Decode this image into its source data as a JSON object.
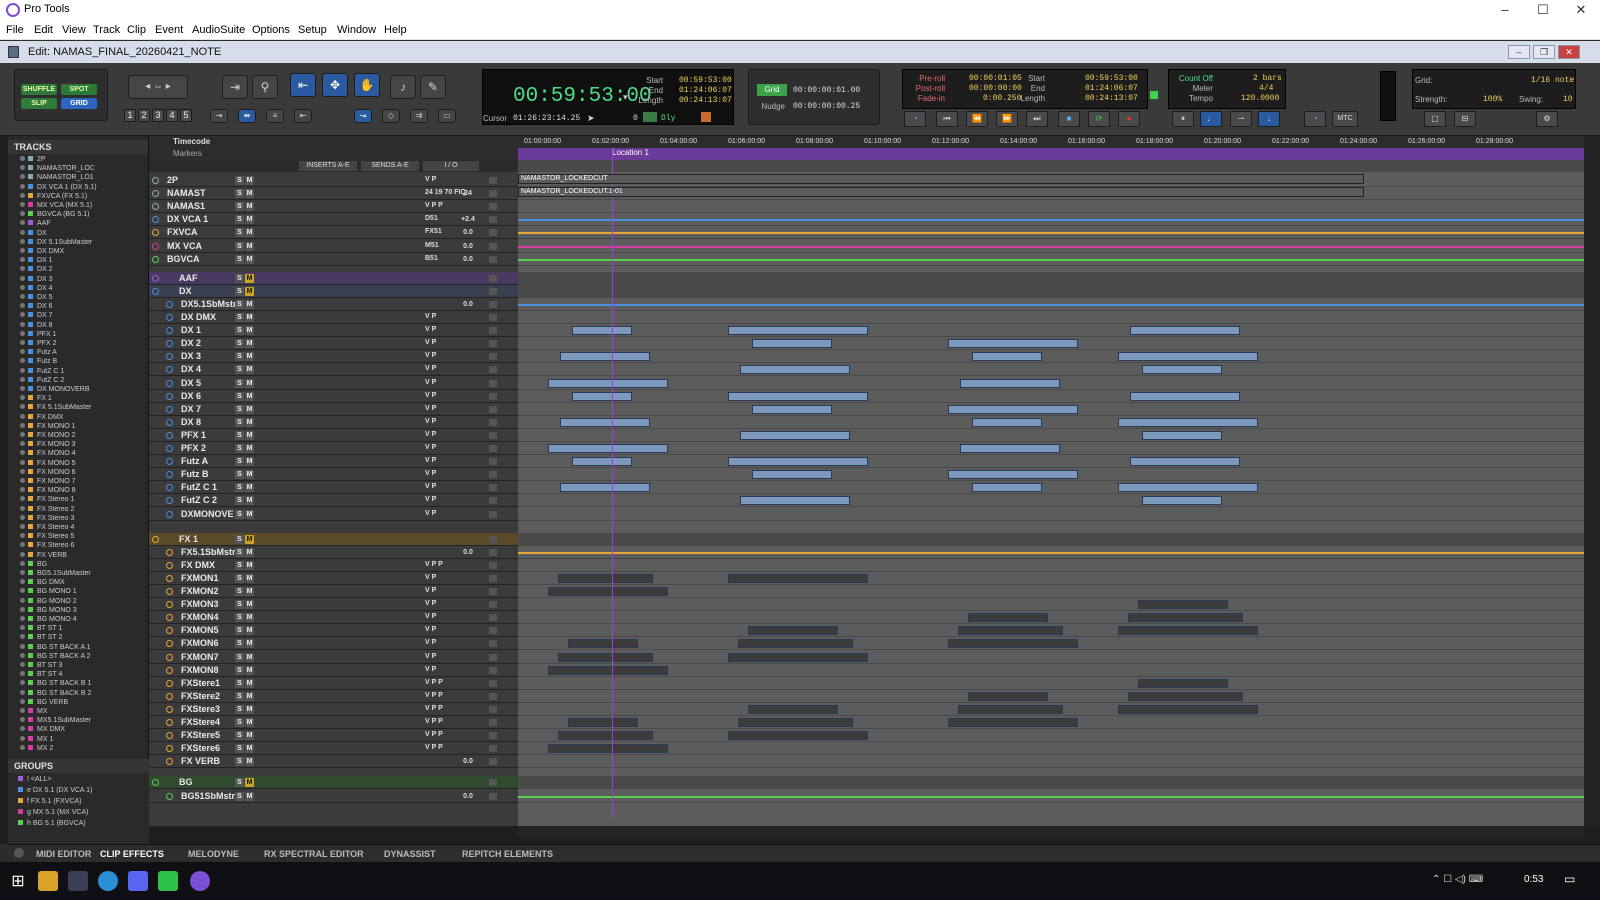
{
  "app": {
    "title": "Pro Tools"
  },
  "menu": [
    "File",
    "Edit",
    "View",
    "Track",
    "Clip",
    "Event",
    "AudioSuite",
    "Options",
    "Setup",
    "Window",
    "Help"
  ],
  "edit_window": {
    "title": "Edit: NAMAS_FINAL_20260421_NOTE"
  },
  "edit_modes": {
    "shuffle": "SHUFFLE",
    "spot": "SPOT",
    "slip": "SLIP",
    "grid": "GRID"
  },
  "zoom_presets": [
    "1",
    "2",
    "3",
    "4",
    "5"
  ],
  "main_counter": {
    "value": "00:59:53:00",
    "start_label": "Start",
    "end_label": "End",
    "length_label": "Length",
    "start": "00:59:53:00",
    "end": "01:24:06:07",
    "length": "00:24:13:07",
    "cursor_label": "Cursor",
    "cursor": "01:26:23:14.25",
    "dly_label": "Dly",
    "zero": "0"
  },
  "grid_nudge": {
    "grid_label": "Grid",
    "grid_value": "00:00:00:01.00",
    "nudge_label": "Nudge",
    "nudge_value": "00:00:00:00.25"
  },
  "transport": {
    "preroll_label": "Pre-roll",
    "preroll": "00:00:01:05",
    "postroll_label": "Post-roll",
    "postroll": "00:00:00:00",
    "fadein_label": "Fade-in",
    "fadein": "0:00.250",
    "start_label": "Start",
    "start": "00:59:53:00",
    "end_label": "End",
    "end": "01:24:06:07",
    "length_label": "Length",
    "length": "00:24:13:07"
  },
  "midi": {
    "countoff_label": "Count Off",
    "countoff": "2 bars",
    "meter_label": "Meter",
    "meter": "4/4",
    "tempo_label": "Tempo",
    "tempo": "120.0000",
    "mtc": "MTC"
  },
  "grid_panel": {
    "grid_label": "Grid:",
    "grid_value": "1/16 note",
    "strength_label": "Strength:",
    "strength": "100%",
    "swing_label": "Swing:",
    "swing": "10"
  },
  "tracks_panel": {
    "header": "TRACKS",
    "items": [
      "2P",
      "NAMASTOR_LOC",
      "NAMASTOR_LO1",
      "DX VCA 1 (DX 5.1)",
      "FXVCA (FX 5.1)",
      "MX VCA (MX 5.1)",
      "BGVCA (BG 5.1)",
      "AAF",
      "DX",
      "DX 5.1SubMaster",
      "DX DMX",
      "DX 1",
      "DX 2",
      "DX 3",
      "DX 4",
      "DX 5",
      "DX 6",
      "DX 7",
      "DX 8",
      "PFX 1",
      "PFX 2",
      "Futz A",
      "Futz B",
      "FutZ C 1",
      "FutZ C 2",
      "DX MONOVERB",
      "FX 1",
      "FX 5.1SubMaster",
      "FX DMX",
      "FX MONO 1",
      "FX MONO 2",
      "FX MONO 3",
      "FX MONO 4",
      "FX MONO 5",
      "FX MONO 6",
      "FX MONO 7",
      "FX MONO 8",
      "FX Stereo 1",
      "FX Stereo 2",
      "FX Stereo 3",
      "FX Stereo 4",
      "FX Stereo 5",
      "FX Stereo 6",
      "FX VERB",
      "BG",
      "BG5.1SubMaster",
      "BG DMX",
      "BG MONO 1",
      "BG MONO 2",
      "BG MONO 3",
      "BG MONO 4",
      "BT ST 1",
      "BT ST 2",
      "BG ST BACK A 1",
      "BG ST BACK A 2",
      "BT ST 3",
      "BT ST 4",
      "BG ST BACK B 1",
      "BG ST BACK B 2",
      "BG VERB",
      "MX",
      "MX5.1SubMaster",
      "MX DMX",
      "MX 1",
      "MX 2"
    ]
  },
  "groups_panel": {
    "header": "GROUPS",
    "items": [
      "<ALL>",
      "DX 5.1 (DX VCA 1)",
      "FX 5.1 (FXVCA)",
      "MX 5.1 (MX VCA)",
      "BG 5.1 (BGVCA)"
    ],
    "letters": [
      "!",
      "e",
      "f",
      "g",
      "h"
    ]
  },
  "edit_header": {
    "timecode": "Timecode",
    "markers": "Markers",
    "inserts": "INSERTS A-E",
    "sends": "SENDS A-E",
    "io": "I / O",
    "location": "Location 1"
  },
  "ruler": [
    "01:00:00:00",
    "01:02:00:00",
    "01:04:00:00",
    "01:06:00:00",
    "01:08:00:00",
    "01:10:00:00",
    "01:12:00:00",
    "01:14:00:00",
    "01:16:00:00",
    "01:18:00:00",
    "01:20:00:00",
    "01:22:00:00",
    "01:24:00:00",
    "01:26:00:00",
    "01:28:00:00"
  ],
  "rows": [
    {
      "name": "2P",
      "color": "#9aa",
      "io": "V P",
      "vol": ""
    },
    {
      "name": "NAMAST",
      "color": "#9aa",
      "io": "24 19 70 FIQ",
      "vol": "24"
    },
    {
      "name": "NAMAS1",
      "color": "#9aa",
      "io": "V P P",
      "vol": ""
    },
    {
      "name": "DX VCA 1",
      "color": "#4a8fe0",
      "io": "D51",
      "vol": "+2.4"
    },
    {
      "name": "FXVCA",
      "color": "#e6a73a",
      "io": "FX51",
      "vol": "0.0"
    },
    {
      "name": "MX VCA",
      "color": "#d23fa0",
      "io": "M51",
      "vol": "0.0"
    },
    {
      "name": "BGVCA",
      "color": "#5ad052",
      "io": "B51",
      "vol": "0.0"
    },
    {
      "name": "AAF",
      "color": "#9a5fd8",
      "io": "",
      "vol": ""
    },
    {
      "name": "DX",
      "color": "#4a8fe0",
      "io": "",
      "vol": ""
    },
    {
      "name": "DX5.1SbMstr",
      "color": "#4a8fe0",
      "io": "",
      "vol": "0.0"
    },
    {
      "name": "DX DMX",
      "color": "#4a8fe0",
      "io": "V P",
      "vol": ""
    },
    {
      "name": "DX 1",
      "color": "#4a8fe0",
      "io": "V P",
      "vol": ""
    },
    {
      "name": "DX 2",
      "color": "#4a8fe0",
      "io": "V P",
      "vol": ""
    },
    {
      "name": "DX 3",
      "color": "#4a8fe0",
      "io": "V P",
      "vol": ""
    },
    {
      "name": "DX 4",
      "color": "#4a8fe0",
      "io": "V P",
      "vol": ""
    },
    {
      "name": "DX 5",
      "color": "#4a8fe0",
      "io": "V P",
      "vol": ""
    },
    {
      "name": "DX 6",
      "color": "#4a8fe0",
      "io": "V P",
      "vol": ""
    },
    {
      "name": "DX 7",
      "color": "#4a8fe0",
      "io": "V P",
      "vol": ""
    },
    {
      "name": "DX 8",
      "color": "#4a8fe0",
      "io": "V P",
      "vol": ""
    },
    {
      "name": "PFX 1",
      "color": "#4a8fe0",
      "io": "V P",
      "vol": ""
    },
    {
      "name": "PFX 2",
      "color": "#4a8fe0",
      "io": "V P",
      "vol": ""
    },
    {
      "name": "Futz A",
      "color": "#4a8fe0",
      "io": "V P",
      "vol": ""
    },
    {
      "name": "Futz B",
      "color": "#4a8fe0",
      "io": "V P",
      "vol": ""
    },
    {
      "name": "FutZ C 1",
      "color": "#4a8fe0",
      "io": "V P",
      "vol": ""
    },
    {
      "name": "FutZ C 2",
      "color": "#4a8fe0",
      "io": "V P",
      "vol": ""
    },
    {
      "name": "DXMONOVE",
      "color": "#4a8fe0",
      "io": "V P",
      "vol": ""
    },
    {
      "name": "FX 1",
      "color": "#e6a73a",
      "io": "",
      "vol": ""
    },
    {
      "name": "FX5.1SbMstr",
      "color": "#e6a73a",
      "io": "",
      "vol": "0.0"
    },
    {
      "name": "FX DMX",
      "color": "#e6a73a",
      "io": "V P P",
      "vol": ""
    },
    {
      "name": "FXMON1",
      "color": "#e6a73a",
      "io": "V P",
      "vol": ""
    },
    {
      "name": "FXMON2",
      "color": "#e6a73a",
      "io": "V P",
      "vol": ""
    },
    {
      "name": "FXMON3",
      "color": "#e6a73a",
      "io": "V P",
      "vol": ""
    },
    {
      "name": "FXMON4",
      "color": "#e6a73a",
      "io": "V P",
      "vol": ""
    },
    {
      "name": "FXMON5",
      "color": "#e6a73a",
      "io": "V P",
      "vol": ""
    },
    {
      "name": "FXMON6",
      "color": "#e6a73a",
      "io": "V P",
      "vol": ""
    },
    {
      "name": "FXMON7",
      "color": "#e6a73a",
      "io": "V P",
      "vol": ""
    },
    {
      "name": "FXMON8",
      "color": "#e6a73a",
      "io": "V P",
      "vol": ""
    },
    {
      "name": "FXStere1",
      "color": "#e6a73a",
      "io": "V P P",
      "vol": ""
    },
    {
      "name": "FXStere2",
      "color": "#e6a73a",
      "io": "V P P",
      "vol": ""
    },
    {
      "name": "FXStere3",
      "color": "#e6a73a",
      "io": "V P P",
      "vol": ""
    },
    {
      "name": "FXStere4",
      "color": "#e6a73a",
      "io": "V P P",
      "vol": ""
    },
    {
      "name": "FXStere5",
      "color": "#e6a73a",
      "io": "V P P",
      "vol": ""
    },
    {
      "name": "FXStere6",
      "color": "#e6a73a",
      "io": "V P P",
      "vol": ""
    },
    {
      "name": "FX VERB",
      "color": "#e6a73a",
      "io": "",
      "vol": "0.0"
    },
    {
      "name": "BG",
      "color": "#5ad052",
      "io": "",
      "vol": ""
    },
    {
      "name": "BG51SbMstr",
      "color": "#5ad052",
      "io": "",
      "vol": "0.0"
    }
  ],
  "clip_labels": {
    "lockedcut": "NAMASTOR_LOCKEDCUT",
    "lockedcut01": "NAMASTOR_LOCKEDCUT.1-01"
  },
  "bottom_tabs": [
    "MIDI EDITOR",
    "CLIP EFFECTS",
    "MELODYNE",
    "RX SPECTRAL EDITOR",
    "DYNASSIST",
    "REPITCH ELEMENTS"
  ],
  "taskbar": {
    "time": "0:53"
  }
}
